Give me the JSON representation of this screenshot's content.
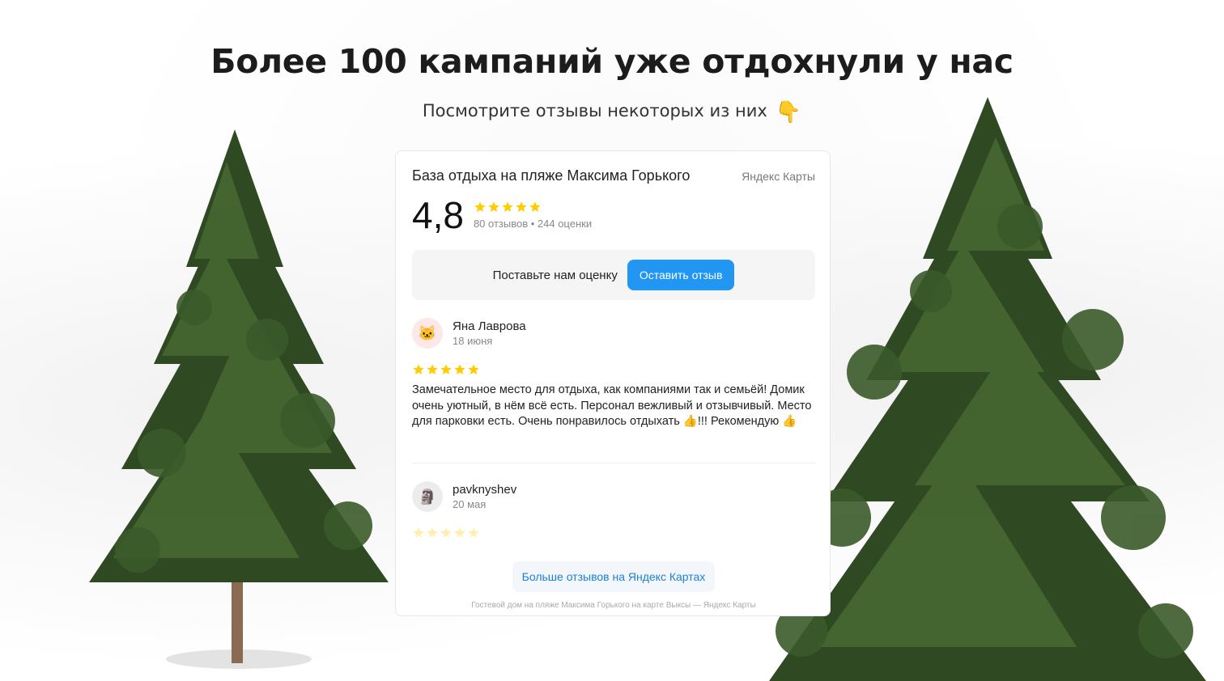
{
  "headline": "Более 100 кампаний уже отдохнули у нас",
  "subheadline": "Посмотрите отзывы некоторых из них",
  "subheadline_emoji": "👇",
  "widget": {
    "title": "База отдыха на пляже Максима Горького",
    "brand": "Яндекс Карты",
    "rating": "4,8",
    "rating_stars": 5,
    "rating_count": "80 отзывов • 244 оценки",
    "cta_text": "Поставьте нам оценку",
    "cta_button": "Оставить отзыв",
    "reviews": [
      {
        "author": "Яна Лаврова",
        "date": "18 июня",
        "avatar": "🐱",
        "stars": 5,
        "text": "Замечательное место для отдыха, как компаниями так и семьёй! Домик очень уютный, в нём всё есть. Персонал вежливый и отзывчивый. Место для парковки есть. Очень понравилось отдыхать 👍!!! Рекомендую 👍"
      },
      {
        "author": "pavknyshev",
        "date": "20 мая",
        "avatar": "🗿",
        "stars": 5,
        "text": ""
      }
    ],
    "more_button": "Больше отзывов на Яндекс Картах",
    "footer": "Гостевой дом на пляже Максима Горького на карте Выксы — Яндекс Карты"
  },
  "colors": {
    "star": "#ffcc00",
    "accent": "#2196f3",
    "link": "#1e7fd6",
    "tree_dark": "#2f4a22",
    "tree_mid": "#4a6b33",
    "trunk": "#8a6a52"
  },
  "icons": {
    "left_decoration": "pine-tree-icon",
    "right_decoration": "pine-tree-icon",
    "star": "star-icon"
  }
}
